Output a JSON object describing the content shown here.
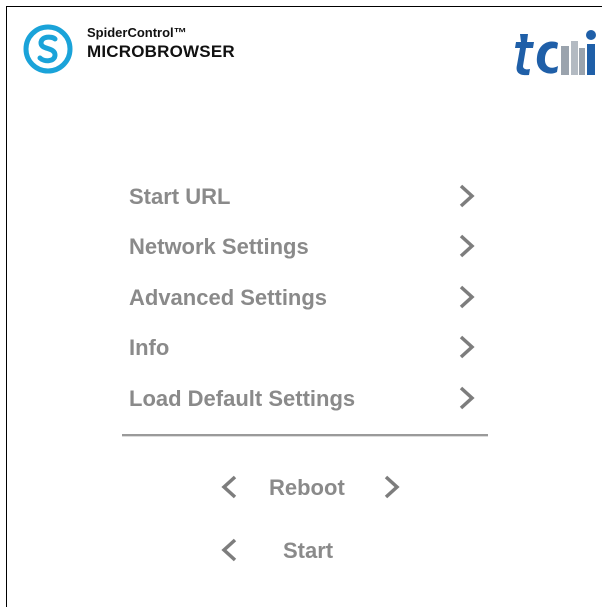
{
  "header": {
    "brand_top": "SpiderControl™",
    "brand_bottom": "MICROBROWSER",
    "brand_icon": "spidercontrol-s-logo",
    "partner_logo": "tci-logo"
  },
  "menu": {
    "items": [
      {
        "label": "Start URL",
        "icon": "chevron-right-icon"
      },
      {
        "label": "Network Settings",
        "icon": "chevron-right-icon"
      },
      {
        "label": "Advanced Settings",
        "icon": "chevron-right-icon"
      },
      {
        "label": "Info",
        "icon": "chevron-right-icon"
      },
      {
        "label": "Load Default Settings",
        "icon": "chevron-right-icon"
      }
    ]
  },
  "actions": {
    "reboot": {
      "label": "Reboot",
      "icon_left": "chevron-left-icon",
      "icon_right": "chevron-right-icon"
    },
    "start": {
      "label": "Start",
      "icon_left": "chevron-left-icon"
    }
  },
  "colors": {
    "text_gray": "#8a8a8a",
    "brand_blue": "#1aa3d9",
    "partner_blue": "#1f5fa8"
  }
}
